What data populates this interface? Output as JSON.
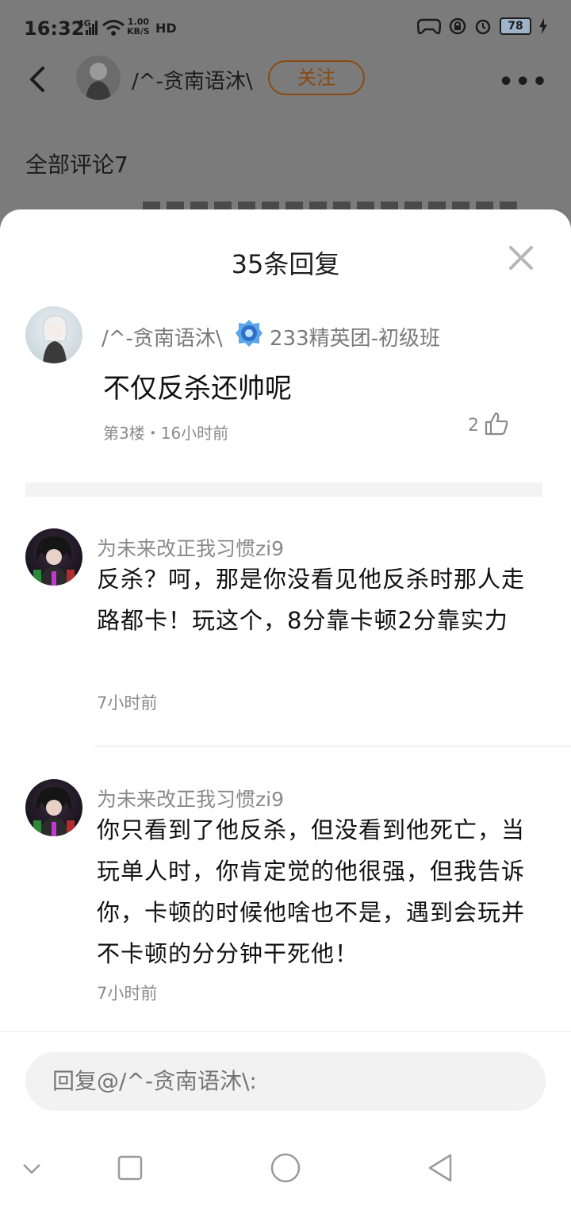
{
  "status_bar": {
    "time": "16:32",
    "network": "4G",
    "speed_value": "1.00",
    "speed_unit": "KB/S",
    "hd": "HD",
    "battery": "78"
  },
  "header": {
    "username": "/^-贪南语沐\\",
    "follow_label": "关注",
    "all_comments": "全部评论7"
  },
  "sheet": {
    "title": "35条回复"
  },
  "main_comment": {
    "username": "/^-贪南语沐\\",
    "badge_text": "233精英团-初级班",
    "text": "不仅反杀还帅呢",
    "meta": "第3楼・16小时前",
    "likes": "2"
  },
  "replies": [
    {
      "username": "为未来改正我习惯zi9",
      "text": "反杀？呵，那是你没看见他反杀时那人走路都卡！玩这个，8分靠卡顿2分靠实力",
      "time": "7小时前"
    },
    {
      "username": "为未来改正我习惯zi9",
      "text": "你只看到了他反杀，但没看到他死亡，当玩单人时，你肯定觉的他很强，但我告诉你，卡顿的时候他啥也不是，遇到会玩并不卡顿的分分钟干死他！",
      "time": "7小时前"
    }
  ],
  "reply_input": {
    "placeholder": "回复@/^-贪南语沐\\:"
  }
}
